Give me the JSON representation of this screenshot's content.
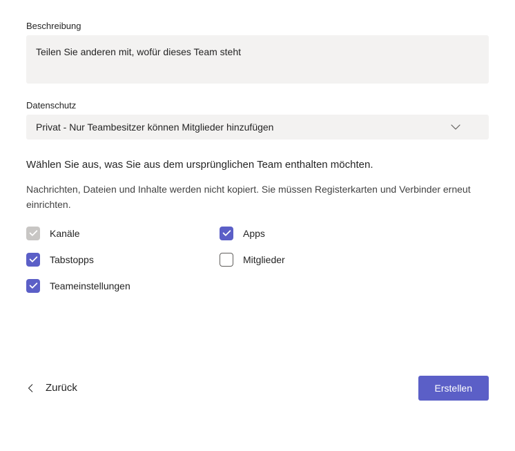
{
  "description": {
    "label": "Beschreibung",
    "placeholder": "Teilen Sie anderen mit, wofür dieses Team steht"
  },
  "privacy": {
    "label": "Datenschutz",
    "selected": "Privat - Nur Teambesitzer können Mitglieder hinzufügen"
  },
  "include": {
    "heading": "Wählen Sie aus, was Sie aus dem ursprünglichen Team enthalten möchten.",
    "subtext": "Nachrichten, Dateien und Inhalte werden nicht kopiert. Sie müssen Registerkarten und Verbinder erneut einrichten.",
    "items": [
      {
        "label": "Kanäle",
        "checked": true,
        "disabled": true
      },
      {
        "label": "Apps",
        "checked": true,
        "disabled": false
      },
      {
        "label": "Tabstopps",
        "checked": true,
        "disabled": false
      },
      {
        "label": "Mitglieder",
        "checked": false,
        "disabled": false
      },
      {
        "label": "Teameinstellungen",
        "checked": true,
        "disabled": false
      }
    ]
  },
  "footer": {
    "back": "Zurück",
    "create": "Erstellen"
  }
}
